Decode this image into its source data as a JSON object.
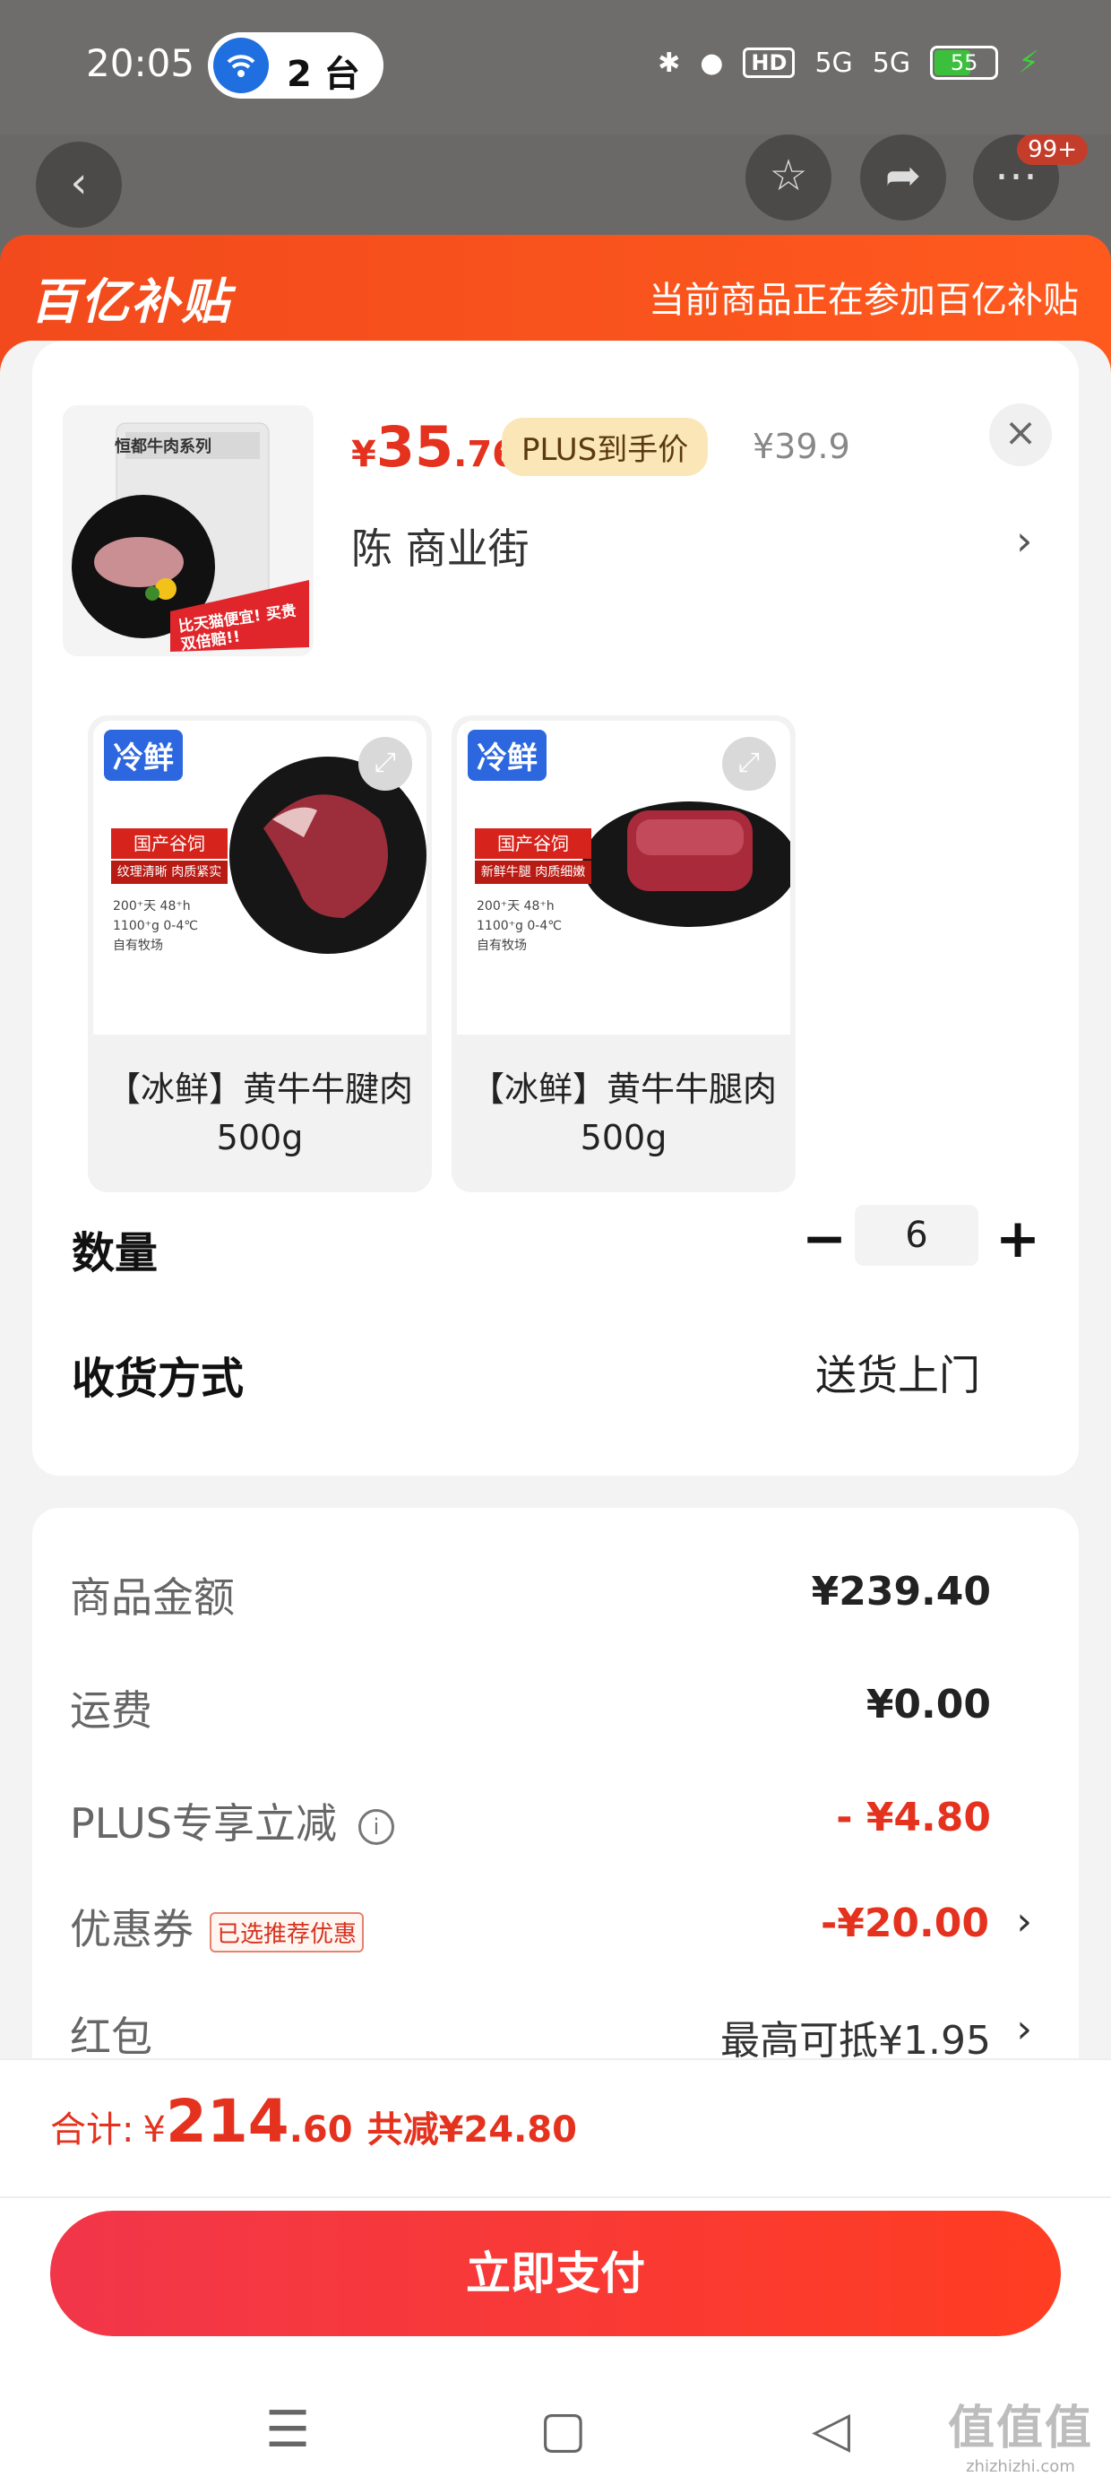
{
  "status_bar": {
    "time": "20:05",
    "hotspot_count": "2 台",
    "hd_label": "HD",
    "signal1": "5G",
    "signal2": "5G",
    "battery": "55"
  },
  "header": {
    "notification_badge": "99+"
  },
  "banner": {
    "logo_text": "百亿补贴",
    "notice": "当前商品正在参加百亿补贴"
  },
  "product": {
    "price_currency": "¥",
    "price_int": "35",
    "price_dec": ".76",
    "plus_tag": "PLUS到手价",
    "original_price": "¥39.9",
    "address": "陈  商业街",
    "thumb_title": "恒都牛肉系列",
    "thumb_promo": "比天猫便宜! 买贵双倍赔!!"
  },
  "skus": [
    {
      "tag": "冷鲜",
      "name": "【冰鲜】黄牛牛腱肉500g",
      "banner": "国产谷饲",
      "sub": "纹理清晰 肉质紧实"
    },
    {
      "tag": "冷鲜",
      "name": "【冰鲜】黄牛牛腿肉500g",
      "banner": "国产谷饲",
      "sub": "新鲜牛腿 肉质细嫩"
    }
  ],
  "sku_specs": {
    "l1": "200⁺天 48⁺h",
    "l2": "1100⁺g 0-4℃",
    "l3": "自有牧场"
  },
  "quantity": {
    "label": "数量",
    "value": "6"
  },
  "delivery": {
    "label": "收货方式",
    "value": "送货上门"
  },
  "fees": {
    "goods_label": "商品金额",
    "goods_value": "¥239.40",
    "shipping_label": "运费",
    "shipping_value": "¥0.00",
    "plus_label": "PLUS专享立减",
    "plus_value": "- ¥4.80",
    "coupon_label": "优惠券",
    "coupon_tag": "已选推荐优惠",
    "coupon_value": "-¥20.00",
    "redpacket_label": "红包",
    "redpacket_value": "最高可抵¥1.95"
  },
  "summary": {
    "label": "合计:",
    "currency": "¥",
    "int": "214",
    "dec": ".60",
    "savings": "共减¥24.80"
  },
  "pay_button": "立即支付",
  "watermark": {
    "line1": "值值值",
    "line2": "zhizhizhi.com"
  },
  "colors": {
    "accent_red": "#e4321e",
    "banner_orange": "#f24a1c",
    "plus_gold": "#fbe6b8",
    "cold_tag_blue": "#2c67e0"
  },
  "icons": [
    "wifi-hotspot-icon",
    "bluetooth-icon",
    "location-icon",
    "back-arrow-icon",
    "favorite-star-icon",
    "share-icon",
    "more-icon",
    "close-icon",
    "chevron-right-icon",
    "expand-icon",
    "info-icon",
    "menu-nav-icon",
    "home-nav-icon",
    "back-nav-icon"
  ]
}
